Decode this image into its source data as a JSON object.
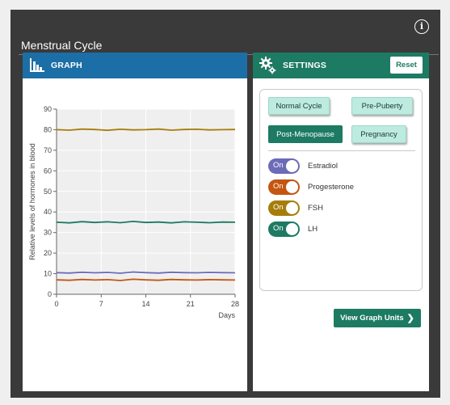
{
  "app": {
    "title": "Menstrual Cycle"
  },
  "graph_panel": {
    "header": "GRAPH"
  },
  "settings_panel": {
    "header": "SETTINGS",
    "reset_label": "Reset",
    "presets": [
      {
        "label": "Normal Cycle",
        "selected": false
      },
      {
        "label": "Pre-Puberty",
        "selected": false
      },
      {
        "label": "Post-Menopause",
        "selected": true
      },
      {
        "label": "Pregnancy",
        "selected": false
      }
    ],
    "toggles": [
      {
        "name": "Estradiol",
        "state": "On",
        "color": "#6b6bb8"
      },
      {
        "name": "Progesterone",
        "state": "On",
        "color": "#c4560f"
      },
      {
        "name": "FSH",
        "state": "On",
        "color": "#a67c0a"
      },
      {
        "name": "LH",
        "state": "On",
        "color": "#1d7a63"
      }
    ],
    "view_units_label": "View Graph Units"
  },
  "chart_data": {
    "type": "line",
    "xlabel": "Days",
    "ylabel": "Relative levels of hormones in blood",
    "xlim": [
      0,
      28
    ],
    "ylim": [
      0,
      90
    ],
    "x_ticks": [
      0,
      7,
      14,
      21,
      28
    ],
    "y_ticks": [
      0,
      10,
      20,
      30,
      40,
      50,
      60,
      70,
      80,
      90
    ],
    "grid": true,
    "x": [
      0,
      2,
      4,
      6,
      8,
      10,
      12,
      14,
      16,
      18,
      20,
      22,
      24,
      26,
      28
    ],
    "series": [
      {
        "name": "Estradiol",
        "color": "#6b6bb8",
        "values": [
          10.5,
          10.3,
          10.7,
          10.4,
          10.6,
          10.2,
          10.8,
          10.5,
          10.3,
          10.7,
          10.5,
          10.4,
          10.6,
          10.5,
          10.4
        ]
      },
      {
        "name": "Progesterone",
        "color": "#c4560f",
        "values": [
          7.0,
          6.8,
          7.2,
          6.9,
          7.1,
          6.7,
          7.3,
          7.0,
          6.8,
          7.2,
          7.0,
          6.9,
          7.1,
          7.0,
          6.9
        ]
      },
      {
        "name": "FSH",
        "color": "#a67c0a",
        "values": [
          80.0,
          79.8,
          80.3,
          80.1,
          79.7,
          80.2,
          79.9,
          80.0,
          80.3,
          79.8,
          80.1,
          80.2,
          79.9,
          80.0,
          80.1
        ]
      },
      {
        "name": "LH",
        "color": "#1d7a63",
        "values": [
          35.0,
          34.7,
          35.3,
          34.9,
          35.2,
          34.8,
          35.4,
          34.9,
          35.1,
          34.7,
          35.2,
          35.0,
          34.8,
          35.1,
          35.0
        ]
      }
    ]
  }
}
